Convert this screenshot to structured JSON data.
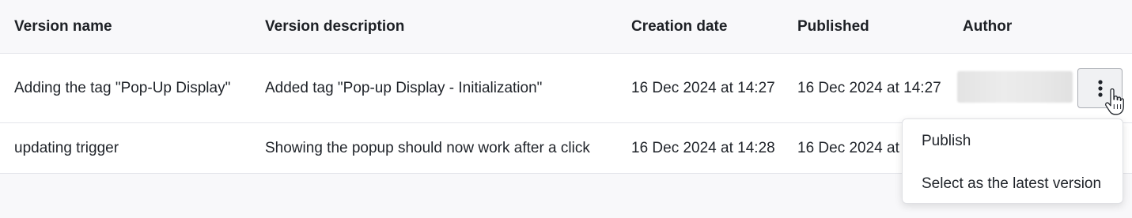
{
  "table": {
    "headers": {
      "name": "Version name",
      "description": "Version description",
      "created": "Creation date",
      "published": "Published",
      "author": "Author"
    },
    "rows": [
      {
        "name": "Adding the tag \"Pop-Up Display\"",
        "description": "Added tag \"Pop-up Display - Initialization\"",
        "created": "16 Dec 2024 at 14:27",
        "published": "16 Dec 2024 at 14:27"
      },
      {
        "name": "updating trigger",
        "description": "Showing the popup should now work after a click",
        "created": "16 Dec 2024 at 14:28",
        "published": "16 Dec 2024 at 14:28"
      }
    ]
  },
  "menu": {
    "items": [
      {
        "label": "Publish"
      },
      {
        "label": "Select as the latest version"
      }
    ]
  },
  "icons": {
    "more_actions": "kebab-vertical-icon",
    "cursor": "hand-pointer-icon"
  },
  "colors": {
    "header_bg": "#f8f8fa",
    "row_bg": "#ffffff",
    "border": "#e4e5ea",
    "text": "#1f2329"
  }
}
